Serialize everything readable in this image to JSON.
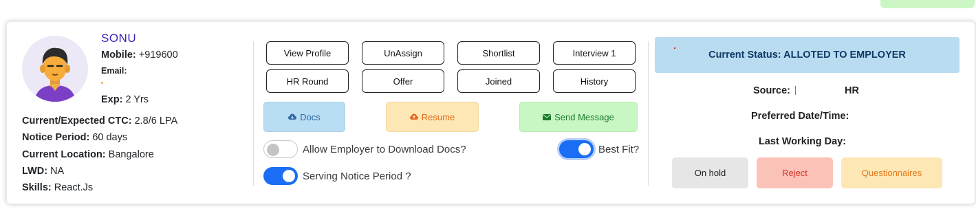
{
  "candidate": {
    "name": "SONU",
    "mobile_label": "Mobile:",
    "mobile": "+919600",
    "email_label": "Email:",
    "exp_label": "Exp:",
    "exp": "2 Yrs",
    "ctc_label": "Current/Expected CTC:",
    "ctc": "2.8/6 LPA",
    "notice_label": "Notice Period:",
    "notice": "60 days",
    "location_label": "Current Location:",
    "location": "Bangalore",
    "lwd_label": "LWD:",
    "lwd": "NA",
    "skills_label": "Skills:",
    "skills": "React.Js",
    "avatar_icon": "user-avatar-icon"
  },
  "actions": {
    "view_profile": "View Profile",
    "unassign": "UnAssign",
    "shortlist": "Shortlist",
    "interview1": "Interview 1",
    "hr_round": "HR Round",
    "offer": "Offer",
    "joined": "Joined",
    "history": "History",
    "docs": "Docs",
    "resume": "Resume",
    "send_message": "Send Message"
  },
  "toggles": {
    "allow_docs_label": "Allow Employer to Download Docs?",
    "allow_docs_on": false,
    "best_fit_label": "Best Fit?",
    "best_fit_on": true,
    "serving_notice_label": "Serving Notice Period ?",
    "serving_notice_on": true
  },
  "status": {
    "text": "Current Status: ALLOTED TO EMPLOYER",
    "source_label": "Source:",
    "source_value": "HR",
    "preferred_label": "Preferred Date/Time:",
    "last_working_label": "Last Working Day:",
    "on_hold": "On hold",
    "reject": "Reject",
    "questionnaires": "Questionnaires"
  },
  "colors": {
    "accent_blue": "#1a6ef5",
    "status_bg": "#b9dcf1",
    "name_color": "#3c22b8"
  }
}
